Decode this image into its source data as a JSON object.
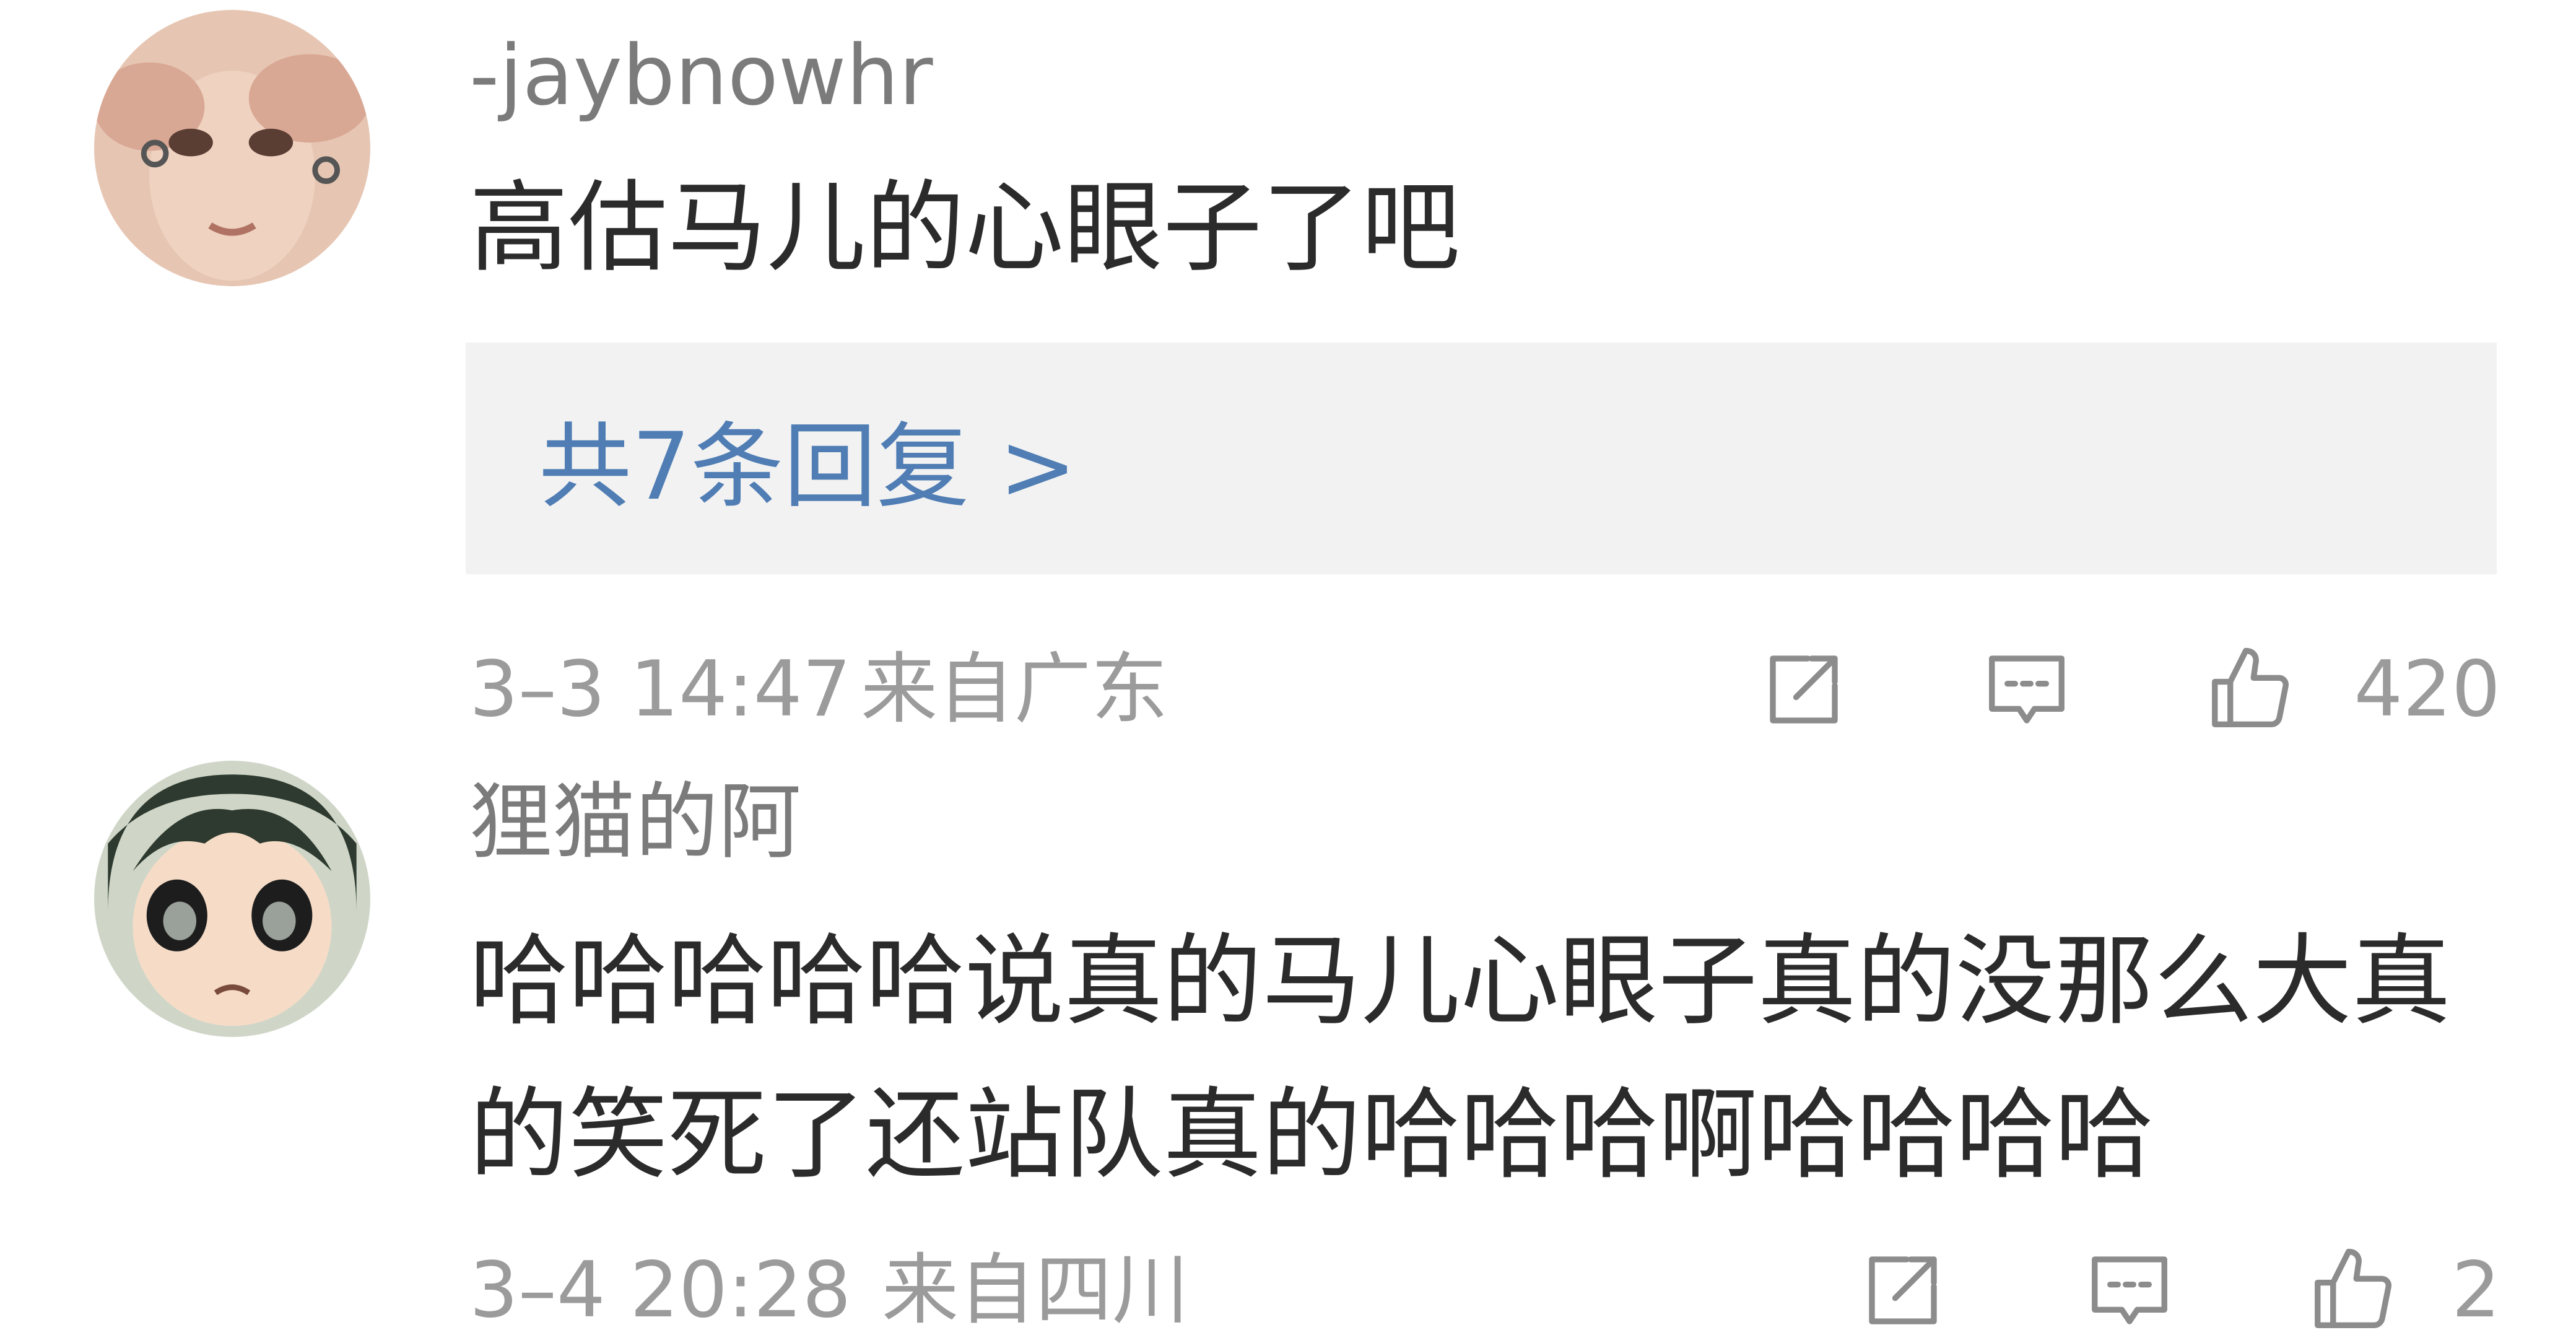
{
  "comments": [
    {
      "username": "-jaybnowhr",
      "text": "高估马儿的心眼子了吧",
      "replies_label": "共7条回复 >",
      "time": "3–3 14:47",
      "location": "来自广东",
      "likes": "420"
    },
    {
      "username": "狸猫的阿",
      "text": "哈哈哈哈哈说真的马儿心眼子真的没那么大真的笑死了还站队真的哈哈哈啊哈哈哈哈",
      "time": "3–4 20:28",
      "location": "来自四川",
      "likes": "2"
    }
  ],
  "icons": {
    "share": "share-icon",
    "comment": "comment-icon",
    "like": "thumbs-up-icon"
  },
  "colors": {
    "username": "#7b7b7b",
    "text": "#2b2b2b",
    "link": "#4f7db4",
    "meta": "#9b9b9b",
    "reply_bg": "#f2f2f2"
  }
}
